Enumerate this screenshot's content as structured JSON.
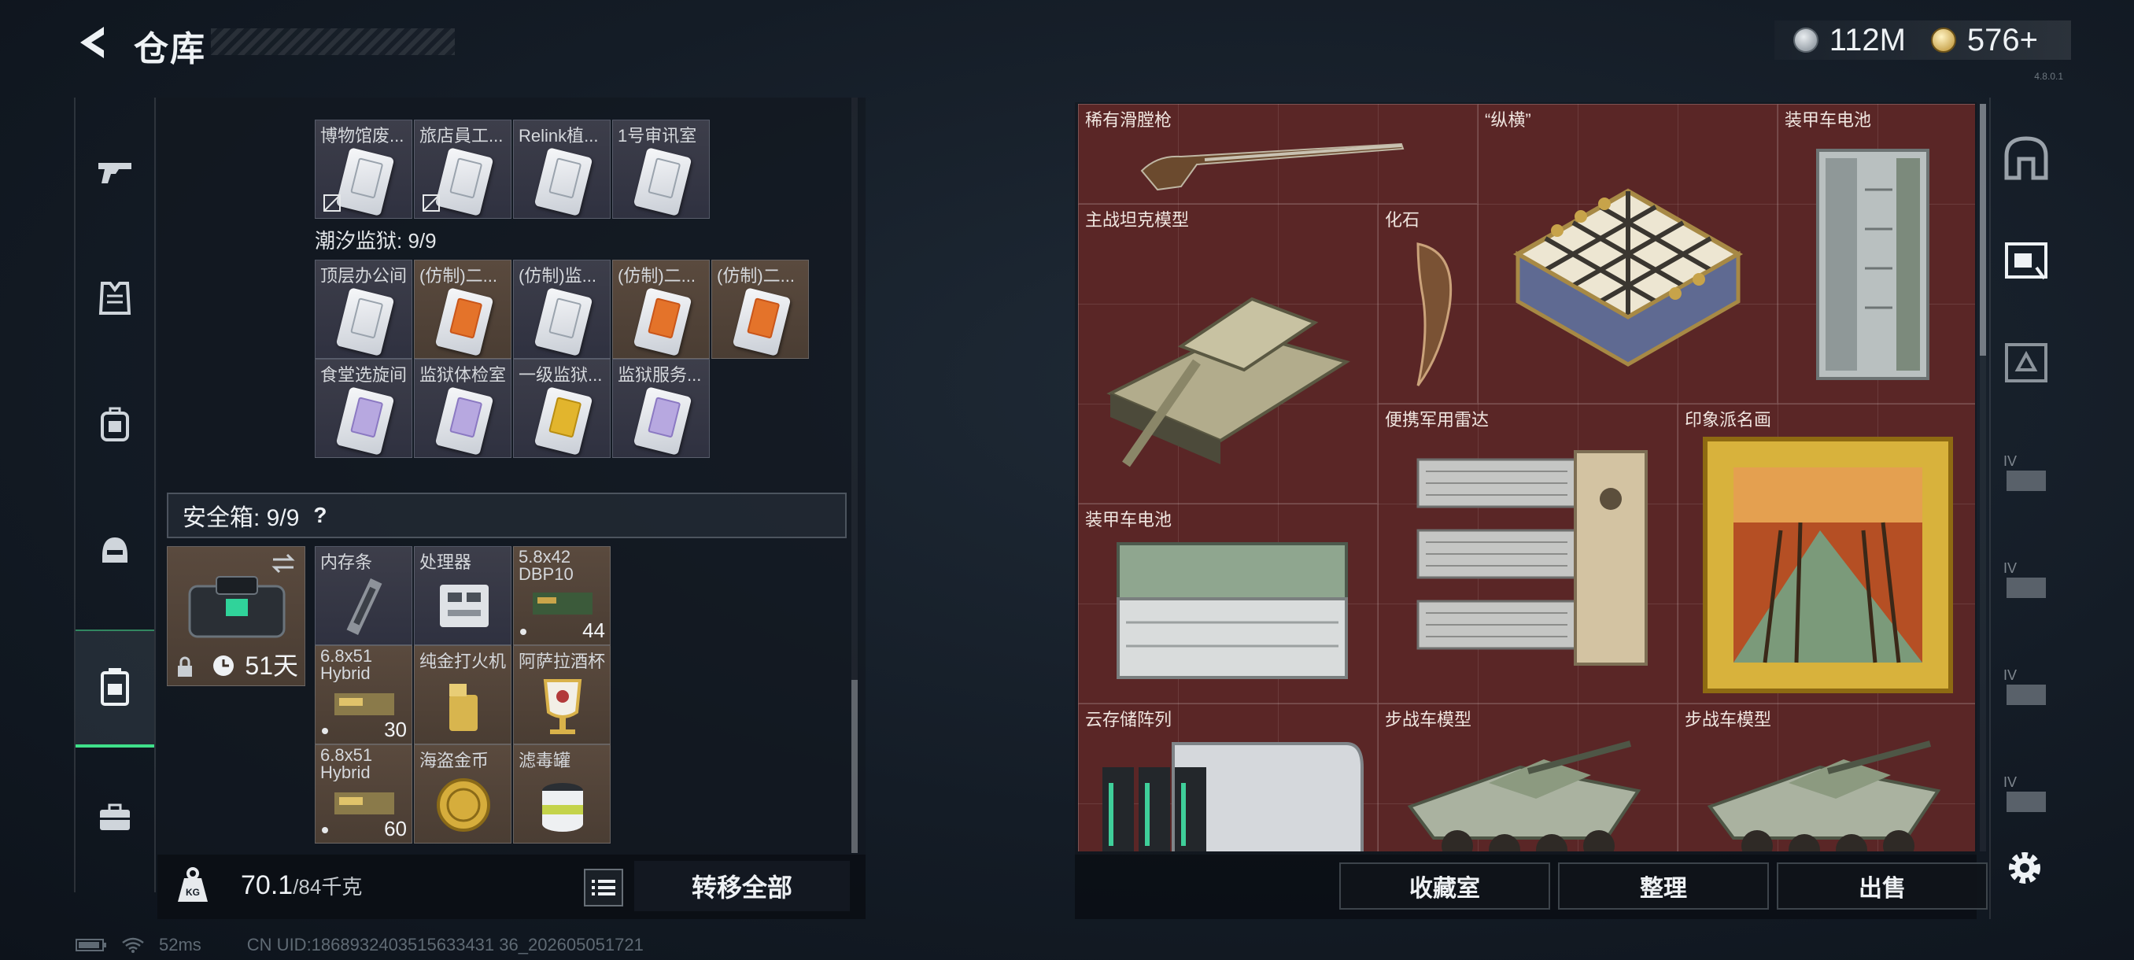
{
  "header": {
    "title": "仓库",
    "currency": [
      {
        "icon": "silver-coin-icon",
        "value": "112M"
      },
      {
        "icon": "gold-coin-icon",
        "value": "576+"
      }
    ]
  },
  "left_sidebar": {
    "items": [
      "gun-icon",
      "armor-vest-icon",
      "backpack-icon",
      "helmet-icon",
      "safe-case-icon",
      "briefcase-icon"
    ],
    "active": "safe-case-icon"
  },
  "keycards_top": [
    "博物馆废...",
    "旅店員工...",
    "Relink植...",
    "1号审讯室"
  ],
  "prison_section": {
    "label": "潮汐监狱: 9/9",
    "row1": [
      "顶层办公间",
      "(仿制)二...",
      "(仿制)监...",
      "(仿制)二...",
      "(仿制)二..."
    ],
    "row2": [
      "食堂选旋间",
      "监狱体检室",
      "一级监狱...",
      "监狱服务..."
    ]
  },
  "safe": {
    "label": "安全箱: 9/9",
    "help": "?",
    "days": "51天",
    "items": [
      {
        "name": "内存条",
        "count": ""
      },
      {
        "name": "处理器",
        "count": ""
      },
      {
        "name": "5.8x42 DBP10",
        "count": "44"
      },
      {
        "name": "6.8x51 Hybrid",
        "count": "30"
      },
      {
        "name": "纯金打火机",
        "count": ""
      },
      {
        "name": "阿萨拉酒杯",
        "count": ""
      },
      {
        "name": "6.8x51 Hybrid",
        "count": "60"
      },
      {
        "name": "海盗金币",
        "count": ""
      },
      {
        "name": "滤毒罐",
        "count": ""
      }
    ]
  },
  "weight": {
    "current": "70.1",
    "max": "/84千克"
  },
  "transfer_all": "转移全部",
  "status": {
    "ping": "52ms",
    "uid": "CN UID:1868932403515633431 36_202605051721"
  },
  "stash_items": [
    {
      "name": "稀有滑膛枪"
    },
    {
      "name": "“纵横”"
    },
    {
      "name": "装甲车电池"
    },
    {
      "name": "主战坦克模型"
    },
    {
      "name": "化石"
    },
    {
      "name": "便携军用雷达"
    },
    {
      "name": "印象派名画"
    },
    {
      "name": "装甲车电池"
    },
    {
      "name": "云存储阵列"
    },
    {
      "name": "步战车模型"
    },
    {
      "name": "步战车模型"
    }
  ],
  "bottom_buttons": {
    "collection": "收藏室",
    "sort": "整理",
    "sell": "出售"
  },
  "right_sidebar": [
    "vault-arch-icon",
    "display-case-icon",
    "trophy-shelf-icon",
    "level4-shelf-icon",
    "level4-shelf-icon",
    "level4-shelf-icon",
    "level4-shelf-icon"
  ],
  "version": "4.8.0.1",
  "colors": {
    "accent_green": "#3fe08a",
    "stash_red": "#5a2626"
  }
}
